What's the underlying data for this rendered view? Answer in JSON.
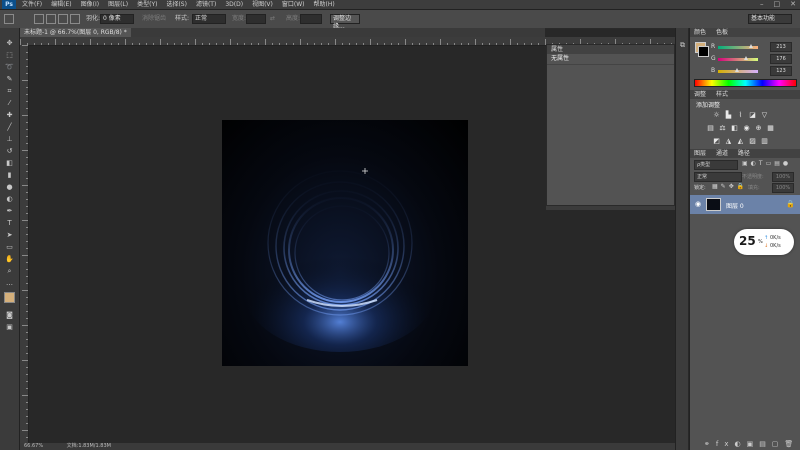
{
  "app": {
    "logo": "Ps"
  },
  "menu": [
    "文件(F)",
    "编辑(E)",
    "图像(I)",
    "图层(L)",
    "类型(Y)",
    "选择(S)",
    "滤镜(T)",
    "3D(D)",
    "视图(V)",
    "窗口(W)",
    "帮助(H)"
  ],
  "window_controls": [
    "–",
    "□",
    "✕"
  ],
  "options_bar": {
    "feather_label": "羽化:",
    "feather_value": "0 像素",
    "antialias_label": "消除锯齿",
    "style_label": "样式:",
    "style_value": "正常",
    "width_label": "宽度:",
    "height_label": "高度:",
    "refine_edge": "调整边缘...",
    "workspace": "基本功能"
  },
  "document_tab": {
    "title": "未标题-1 @ 66.7%(图层 0, RGB/8) *"
  },
  "properties_panel": {
    "header": "属性",
    "content": "无属性"
  },
  "color_panel": {
    "tabs": [
      "颜色",
      "色板"
    ],
    "channels": [
      {
        "label": "R",
        "value": "213",
        "fraction": 0.835
      },
      {
        "label": "G",
        "value": "176",
        "fraction": 0.69
      },
      {
        "label": "B",
        "value": "123",
        "fraction": 0.482
      }
    ],
    "foreground": "#d5b07b",
    "background": "#000000"
  },
  "adjustments_panel": {
    "tabs": [
      "调整",
      "样式"
    ],
    "title": "添加调整"
  },
  "layers_panel": {
    "tabs": [
      "图层",
      "通道",
      "路径"
    ],
    "kind_label": "ρ类型",
    "blend_mode": "正常",
    "opacity_label": "不透明度:",
    "opacity_value": "100%",
    "lock_label": "锁定:",
    "fill_label": "填充:",
    "fill_value": "100%",
    "layer_name": "图层 0"
  },
  "speed_widget": {
    "percent": "25",
    "percent_suffix": "%",
    "up": "0K/s",
    "down": "0K/s"
  },
  "status_bar": {
    "zoom": "66.67%",
    "doc_info": "文档:1.83M/1.83M"
  }
}
